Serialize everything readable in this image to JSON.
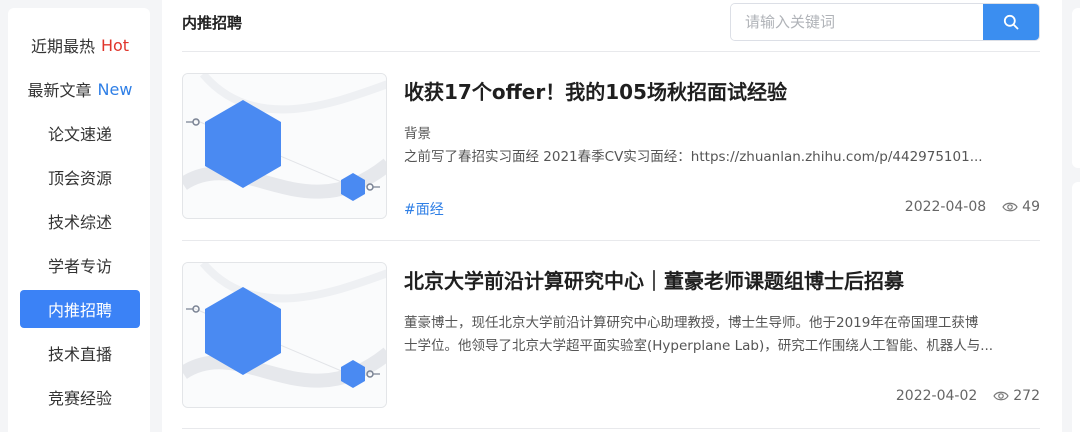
{
  "sidebar": {
    "items": [
      {
        "label": "近期最热",
        "badge": "Hot"
      },
      {
        "label": "最新文章",
        "badge": "New"
      },
      {
        "label": "论文速递"
      },
      {
        "label": "顶会资源"
      },
      {
        "label": "技术综述"
      },
      {
        "label": "学者专访"
      },
      {
        "label": "内推招聘",
        "active": true
      },
      {
        "label": "技术直播"
      },
      {
        "label": "竞赛经验"
      }
    ]
  },
  "header": {
    "title": "内推招聘",
    "search_placeholder": "请输入关键词",
    "search_icon": "search-icon"
  },
  "articles": [
    {
      "title": "收获17个offer！我的105场秋招面试经验",
      "line1": "背景",
      "line2": "之前写了春招实习面经 2021春季CV实习面经：https://zhuanlan.zhihu.com/p/442975101...",
      "tag": "#面经",
      "date": "2022-04-08",
      "views": "49"
    },
    {
      "title": "北京大学前沿计算研究中心｜董豪老师课题组博士后招募",
      "line1": "董豪博士，现任北京大学前沿计算研究中心助理教授，博士生导师。他于2019年在帝国理工获博",
      "line2": "士学位。他领导了北京大学超平面实验室(Hyperplane Lab)，研究工作围绕人工智能、机器人与...",
      "tag": "",
      "date": "2022-04-02",
      "views": "272"
    }
  ],
  "colors": {
    "accent": "#3b82f6",
    "hot": "#e0352b",
    "new": "#2f7fe6",
    "hexagon": "#4a8af2"
  }
}
